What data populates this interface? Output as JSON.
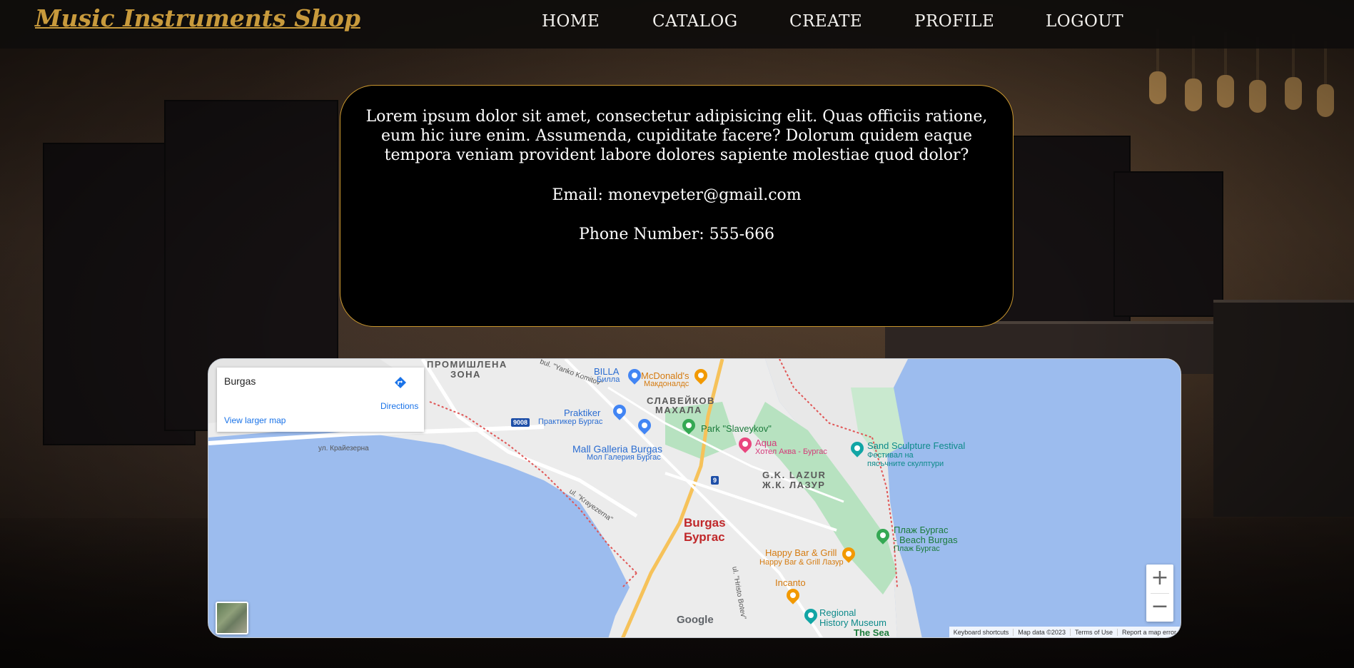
{
  "header": {
    "logo": "Music Instruments Shop",
    "nav": [
      "HOME",
      "CATALOG",
      "CREATE",
      "PROFILE",
      "LOGOUT"
    ]
  },
  "info": {
    "description": "Lorem ipsum dolor sit amet, consectetur adipisicing elit. Quas officiis ratione, eum hic iure enim. Assumenda, cupiditate facere? Dolorum quidem eaque tempora veniam provident labore dolores sapiente molestiae quod dolor?",
    "email": "Email: monevpeter@gmail.com",
    "phone": "Phone Number: 555-666"
  },
  "map": {
    "place_name": "Burgas",
    "directions_label": "Directions",
    "larger_map_label": "View larger map",
    "zoom_in": "+",
    "zoom_out": "−",
    "google_logo": "Google",
    "attribution": [
      "Keyboard shortcuts",
      "Map data ©2023",
      "Terms of Use",
      "Report a map error"
    ],
    "labels": {
      "industrial_zone_1": "ПРОМИШЛЕНА",
      "industrial_zone_2": "ЗОНА",
      "road_yanko": "bul. \"Yanko Komitov\"",
      "billa": "BILLA",
      "billa_bg": "Билла",
      "mcdonalds": "McDonald's",
      "mcdonalds_bg": "Макдоналдс",
      "slaveykov_1": "СЛАВЕЙКОВ",
      "slaveykov_2": "МАХАЛА",
      "praktiker": "Praktiker",
      "praktiker_bg": "Практикер Бургас",
      "route_9008": "9008",
      "park_slaveykov": "Park \"Slaveykov\"",
      "mall_galleria": "Mall Galleria Burgas",
      "mall_galleria_bg": "Мол Галерия Бургас",
      "aqua": "Aqua",
      "aqua_bg": "Хотел Аква - Бургас",
      "sand_festival": "Sand Sculpture Festival",
      "sand_festival_bg_1": "Фестивал на",
      "sand_festival_bg_2": "пясъчните скулптури",
      "road_kraiezerna": "ул. Крайезерна",
      "lazur_1": "G.K. LAZUR",
      "lazur_2": "Ж.К. ЛАЗУР",
      "route_9": "9",
      "road_krayezerna_en": "ul. \"Krayezerna\"",
      "city_en": "Burgas",
      "city_bg": "Бургас",
      "beach_1": "Плаж Бургас",
      "beach_2": "- Beach Burgas",
      "beach_3": "Плаж Бургас",
      "happy_bar": "Happy Bar & Grill",
      "happy_bar_bg": "Happy Bar & Grill Лазур",
      "incanto": "Incanto",
      "road_hristo": "ul. \"Hristo Botev\"",
      "regional_museum_1": "Regional",
      "regional_museum_2": "History Museum",
      "the_sea": "The Sea"
    }
  },
  "colors": {
    "accent_gold": "#c89a3c",
    "card_border": "#c8962e",
    "water": "#9cbcee",
    "link_blue": "#1a73e8"
  }
}
